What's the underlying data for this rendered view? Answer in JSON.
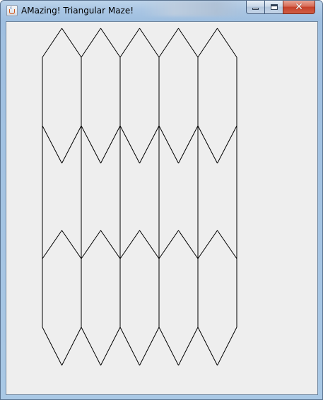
{
  "window": {
    "title": "AMazing! Triangular Maze!",
    "icon": "java-app-icon",
    "controls": {
      "minimize_icon": "minimize-icon",
      "maximize_icon": "maximize-icon",
      "close_icon": "close-icon",
      "close_glyph": "✕"
    }
  },
  "maze": {
    "columns": 5,
    "stroke_color": "#000000",
    "background_color": "#eeeeee"
  }
}
